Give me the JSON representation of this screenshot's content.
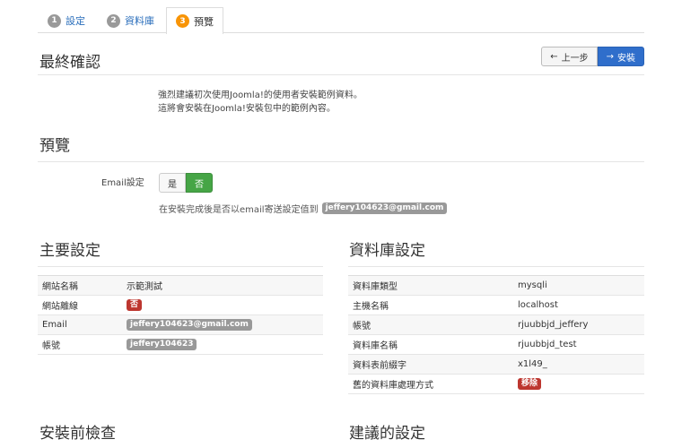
{
  "tabs": [
    {
      "num": "1",
      "label": "設定"
    },
    {
      "num": "2",
      "label": "資料庫"
    },
    {
      "num": "3",
      "label": "預覽"
    }
  ],
  "header": {
    "title": "最終確認",
    "prev_label": "上一步",
    "install_label": "安裝"
  },
  "intro": {
    "line1": "強烈建議初次使用Joomla!的使用者安裝範例資料。",
    "line2": "這將會安裝在Joomla!安裝包中的範例內容。"
  },
  "preview": {
    "title": "預覽",
    "email_label": "Email設定",
    "yes_label": "是",
    "no_label": "否",
    "selected": "否",
    "help_text": "在安裝完成後是否以email寄送設定值到",
    "help_email": "jeffery104623@gmail.com"
  },
  "main_settings": {
    "title": "主要設定",
    "rows": [
      {
        "label": "網站名稱",
        "value": "示範測試",
        "badge": ""
      },
      {
        "label": "網站離線",
        "value": "",
        "badge": "否"
      },
      {
        "label": "Email",
        "value": "",
        "badge": "jeffery104623@gmail.com"
      },
      {
        "label": "帳號",
        "value": "",
        "badge": "jeffery104623"
      }
    ]
  },
  "db_settings": {
    "title": "資料庫設定",
    "rows": [
      {
        "label": "資料庫類型",
        "value": "mysqli",
        "badge": ""
      },
      {
        "label": "主機名稱",
        "value": "localhost",
        "badge": ""
      },
      {
        "label": "帳號",
        "value": "rjuubbjd_jeffery",
        "badge": ""
      },
      {
        "label": "資料庫名稱",
        "value": "rjuubbjd_test",
        "badge": ""
      },
      {
        "label": "資料表前綴字",
        "value": "x1l49_",
        "badge": ""
      },
      {
        "label": "舊的資料庫處理方式",
        "value": "",
        "badge": "移除"
      }
    ]
  },
  "bottom": {
    "precheck_title": "安裝前檢查",
    "recommended_title": "建議的設定"
  },
  "colors": {
    "accent": "#2f6ecb",
    "active_tab_badge": "#f89406",
    "toggle_no": "#46a546",
    "badge_red": "#bd362f",
    "badge_gray": "#999999"
  }
}
